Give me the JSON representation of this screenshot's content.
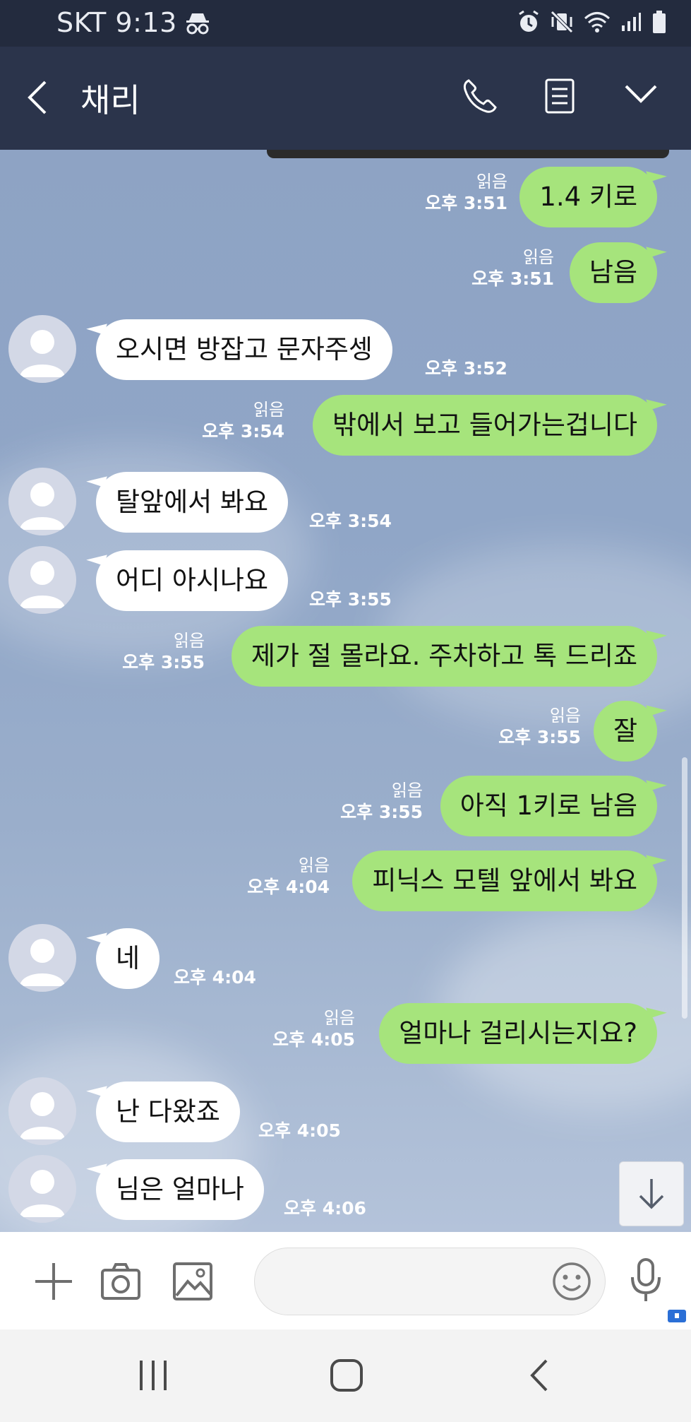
{
  "status_bar": {
    "carrier": "SKT",
    "time": "9:13"
  },
  "header": {
    "title": "채리"
  },
  "messages": [
    {
      "side": "out",
      "text": "1.4 키로",
      "read": "읽음",
      "time": "오후 3:51"
    },
    {
      "side": "out",
      "text": "남음",
      "read": "읽음",
      "time": "오후 3:51"
    },
    {
      "side": "in",
      "text": "오시면  방잡고 문자주셍",
      "time": "오후 3:52"
    },
    {
      "side": "out",
      "text": "밖에서 보고 들어가는겁니다",
      "read": "읽음",
      "time": "오후 3:54"
    },
    {
      "side": "in",
      "text": "탈앞에서 봐요",
      "time": "오후 3:54"
    },
    {
      "side": "in",
      "text": "어디 아시나요",
      "time": "오후 3:55"
    },
    {
      "side": "out",
      "text": "제가 절 몰라요. 주차하고 톡 드리죠",
      "read": "읽음",
      "time": "오후 3:55"
    },
    {
      "side": "out",
      "text": "잘",
      "read": "읽음",
      "time": "오후 3:55"
    },
    {
      "side": "out",
      "text": "아직 1키로 남음",
      "read": "읽음",
      "time": "오후 3:55"
    },
    {
      "side": "out",
      "text": "피닉스 모텔 앞에서 봐요",
      "read": "읽음",
      "time": "오후 4:04"
    },
    {
      "side": "in",
      "text": "네",
      "time": "오후 4:04"
    },
    {
      "side": "out",
      "text": "얼마나 걸리시는지요?",
      "read": "읽음",
      "time": "오후 4:05"
    },
    {
      "side": "in",
      "text": "난 다왔죠",
      "time": "오후 4:05"
    },
    {
      "side": "in",
      "text": "님은 얼마나",
      "time": "오후 4:06"
    }
  ],
  "input": {
    "placeholder": ""
  },
  "colors": {
    "header": "#2b344b",
    "outgoing_bubble": "#a6e47c",
    "incoming_bubble": "#ffffff",
    "chat_background": "#90a6c7"
  },
  "icons": [
    "incognito-icon",
    "alarm-icon",
    "vibrate-off-icon",
    "wifi-icon",
    "signal-icon",
    "battery-icon",
    "back-icon",
    "phone-icon",
    "menu-icon",
    "chevron-down-icon",
    "plus-icon",
    "camera-icon",
    "image-icon",
    "emoji-icon",
    "mic-icon",
    "arrow-down-icon",
    "recent-apps-icon",
    "home-icon",
    "nav-back-icon"
  ]
}
